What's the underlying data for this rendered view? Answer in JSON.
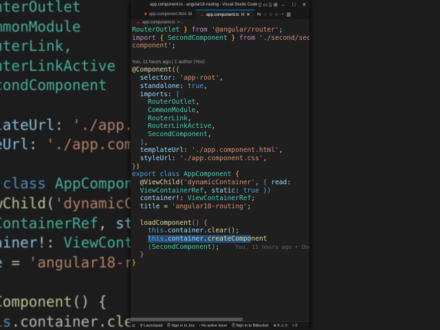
{
  "window": {
    "title": "app.component.ts - angular18-routing - Visual Studio Code"
  },
  "tabs": [
    {
      "label": "app.component.html",
      "badge": "M"
    },
    {
      "label": "app.component.ts",
      "badge": "M"
    }
  ],
  "breadcrumb": {
    "file": "app.component.ts",
    "rest": "> ..."
  },
  "codelens": "You, 11 hours ago | 1 author (You)",
  "blame": "You, 11 hours ago • Unc",
  "status": {
    "launchpad": "Launchpad",
    "jira": "Sign in to Jira",
    "issue": "No active issue",
    "bitbucket": "Sign in to Bitbucket",
    "errors": "0",
    "warnings": "0",
    "ports": "0"
  }
}
